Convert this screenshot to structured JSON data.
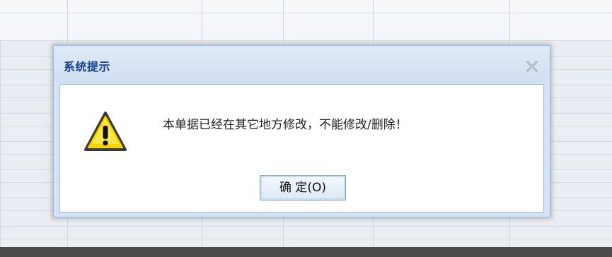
{
  "dialog": {
    "title": "系统提示",
    "message": "本单据已经在其它地方修改，不能修改/删除！",
    "ok_label": "确 定(O)",
    "close_icon": "close-icon",
    "warning_icon": "warning-icon"
  },
  "colors": {
    "title_text": "#15428b",
    "dialog_border": "#99bbe8",
    "header_bg": "#d4e2f3",
    "warning_fill": "#f5d400",
    "bottom_bar": "#4a4a4a"
  }
}
